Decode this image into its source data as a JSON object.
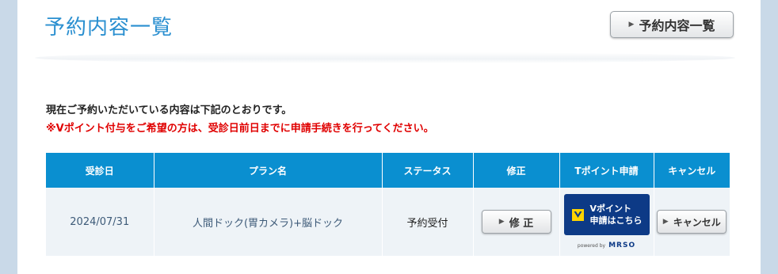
{
  "page": {
    "title": "予約内容一覧",
    "list_button_label": "予約内容一覧",
    "intro_text": "現在ご予約いただいている内容は下記のとおりです。",
    "notice_text": "※Vポイント付与をご希望の方は、受診日前日までに申請手続きを行ってください。"
  },
  "table": {
    "headers": {
      "date": "受診日",
      "plan": "プラン名",
      "status": "ステータス",
      "edit": "修正",
      "point": "Tポイント申請",
      "cancel": "キャンセル"
    },
    "rows": [
      {
        "date": "2024/07/31",
        "plan": "人間ドック(胃カメラ)+脳ドック",
        "status": "予約受付",
        "edit_label": "修 正",
        "point_button_line1": "Vポイント",
        "point_button_line2": "申請はこちら",
        "powered_by": "powered by",
        "powered_brand": "MRSO",
        "cancel_label": "キャンセル"
      }
    ]
  },
  "colors": {
    "accent": "#2a8fd0",
    "table_header": "#0a8fd0",
    "notice": "#e00000",
    "vpoint_button": "#0d3a86",
    "vpoint_logo": "#ffd400"
  }
}
